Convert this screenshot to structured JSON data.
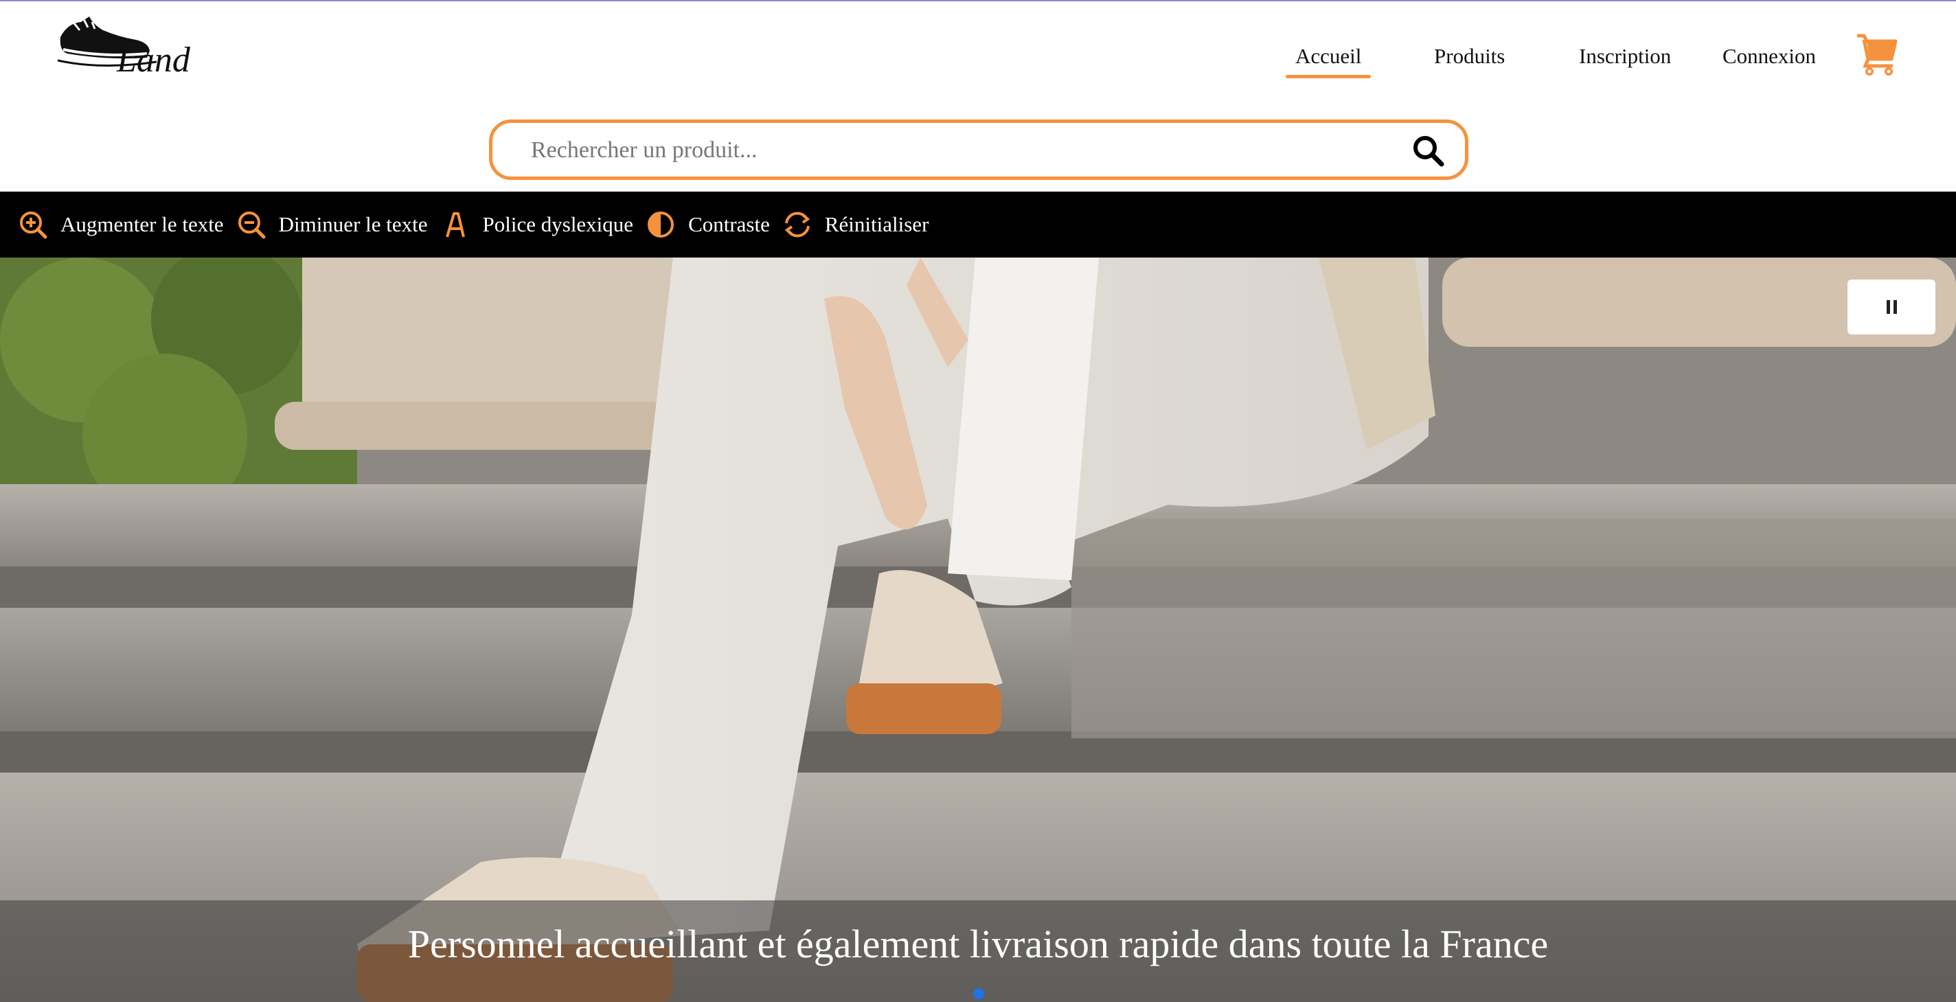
{
  "header": {
    "logo_alt": "Land",
    "nav": [
      {
        "label": "Accueil",
        "active": true
      },
      {
        "label": "Produits",
        "active": false
      },
      {
        "label": "Inscription",
        "active": false
      },
      {
        "label": "Connexion",
        "active": false
      }
    ],
    "cart_icon": "shopping-cart-icon"
  },
  "search": {
    "placeholder": "Rechercher un produit...",
    "icon": "search-icon"
  },
  "accessibility_bar": {
    "items": [
      {
        "label": "Augmenter le texte",
        "icon": "zoom-in-icon"
      },
      {
        "label": "Diminuer le texte",
        "icon": "zoom-out-icon"
      },
      {
        "label": "Police dyslexique",
        "icon": "font-a-icon"
      },
      {
        "label": "Contraste",
        "icon": "contrast-icon"
      },
      {
        "label": "Réinitialiser",
        "icon": "refresh-icon"
      }
    ]
  },
  "hero": {
    "caption": "Personnel accueillant et également livraison rapide dans toute la France",
    "pause_icon": "pause-icon",
    "slides_count": 1,
    "active_slide": 1
  },
  "colors": {
    "accent": "#f5923e",
    "bar_bg": "#000000",
    "dot_active": "#1e73e8"
  }
}
